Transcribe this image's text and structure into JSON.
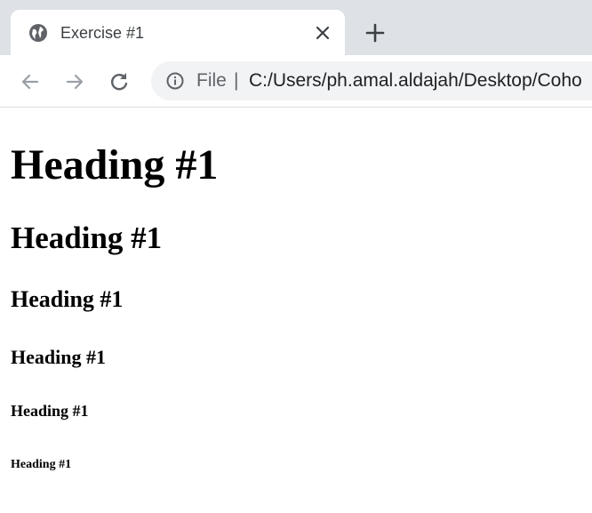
{
  "browser": {
    "tab": {
      "title": "Exercise #1",
      "favicon": "globe-icon",
      "close_icon": "close-icon"
    },
    "new_tab_icon": "plus-icon",
    "toolbar": {
      "back_icon": "arrow-left-icon",
      "forward_icon": "arrow-right-icon",
      "reload_icon": "reload-icon",
      "info_icon": "info-icon",
      "scheme": "File",
      "separator": "|",
      "url": "C:/Users/ph.amal.aldajah/Desktop/Coho"
    },
    "colors": {
      "tabstrip": "#dee1e6",
      "omnibox": "#f1f3f4",
      "icon": "#5f6368"
    }
  },
  "page": {
    "headings": {
      "h1": "Heading #1",
      "h2": "Heading #1",
      "h3": "Heading #1",
      "h4": "Heading #1",
      "h5": "Heading #1",
      "h6": "Heading #1"
    }
  }
}
